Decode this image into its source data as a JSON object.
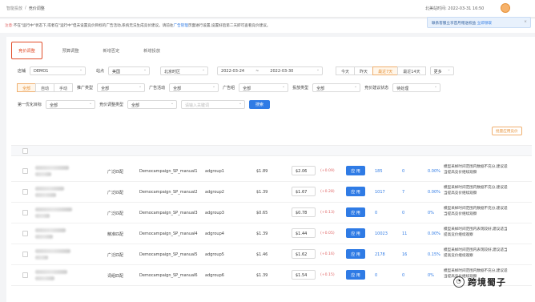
{
  "header": {
    "crumb1": "智能投放",
    "crumb_sep": "/",
    "crumb2": "竞价调整",
    "site_time_label": "北美站时间:",
    "site_time": "2022-03-31 16:50"
  },
  "notice": {
    "prefix": "注意:",
    "text1": "不在\"运行中\"状态下,或者在\"运行中\"但未设置竞价目标的广告活动,系统无法生成竞价建议。请前往",
    "link": "广告管理",
    "text2": "页面进行设置,设置好后第二天即可查看竞价建议。"
  },
  "promo": {
    "text": "联系客服立享首月赠送权益",
    "link": "立即领取",
    "close": "×"
  },
  "tabs": [
    {
      "label": "竞价调整"
    },
    {
      "label": "预算调整"
    },
    {
      "label": "新增否定"
    },
    {
      "label": "新增投放"
    }
  ],
  "filters1": {
    "shop_label": "店铺",
    "shop": "DEMO1",
    "site_label": "站点",
    "site": "美国",
    "timezone": "北京时区",
    "date_from": "2022-03-24",
    "date_sep": "~",
    "date_to": "2022-03-30",
    "quick": [
      "今天",
      "昨天",
      "最近7天",
      "最近14天"
    ],
    "more": "更多"
  },
  "filters2": {
    "all1": "全部",
    "mode1": "自动",
    "mode2": "手动",
    "ad_type_label": "推广类型",
    "ad_type": "全部",
    "campaign_label": "广告活动",
    "campaign": "全部",
    "group_label": "广告组",
    "group": "全部",
    "match_label": "投放类型",
    "match": "全部",
    "status_label": "竞价建议状态",
    "status": "待处理"
  },
  "filters3": {
    "seg_label": "第一优化目标",
    "seg": "全部",
    "bid_label": "竞价调整类型",
    "bid": "全部",
    "search_placeholder": "请输入关键词",
    "query_button": "搜索"
  },
  "apply_all": "批量应用竞价",
  "rows": [
    {
      "match": "广泛匹配",
      "campaign": "Democampaign_SP_manual1",
      "group": "adgroup1",
      "bid": "$1.89",
      "new_bid": "$2.06",
      "change": "(+0.09)",
      "apply": "应 用",
      "clicks": "185",
      "orders": "0",
      "acos": "0.00%",
      "msg": "模型采样时间范围内数据不充分,建议适当提高竞价继续观察"
    },
    {
      "match": "广泛匹配",
      "campaign": "Democampaign_SP_manual2",
      "group": "adgroup2",
      "bid": "$1.39",
      "new_bid": "$1.67",
      "change": "(+0.28)",
      "apply": "应 用",
      "clicks": "1017",
      "orders": "7",
      "acos": "0.00%",
      "msg": "模型采样时间范围内数据不充分,建议适当提高竞价继续观察"
    },
    {
      "match": "广泛匹配",
      "campaign": "Democampaign_SP_manual3",
      "group": "adgroup3",
      "bid": "$0.65",
      "new_bid": "$0.78",
      "change": "(+0.13)",
      "apply": "应 用",
      "clicks": "0",
      "orders": "0",
      "acos": "0%",
      "msg": "模型采样时间范围内数据不充分,建议适当提高竞价继续观察"
    },
    {
      "match": "精准匹配",
      "campaign": "Democampaign_SP_manual4",
      "group": "adgroup4",
      "bid": "$1.39",
      "new_bid": "$1.44",
      "change": "(+0.05)",
      "apply": "应 用",
      "clicks": "10023",
      "orders": "11",
      "acos": "0.00%",
      "msg": "模型采样时间范围内表现较好,建议适当提高竞价继续观察"
    },
    {
      "match": "广泛匹配",
      "campaign": "Democampaign_SP_manual5",
      "group": "adgroup5",
      "bid": "$1.46",
      "new_bid": "$1.62",
      "change": "(+0.16)",
      "apply": "应 用",
      "clicks": "2178",
      "orders": "16",
      "acos": "0.15%",
      "msg": "模型采样时间范围内表现较好,建议适当提高竞价继续观察"
    },
    {
      "match": "词组匹配",
      "campaign": "Democampaign_SP_manual6",
      "group": "adgroup6",
      "bid": "$1.39",
      "new_bid": "$1.54",
      "change": "(+0.15)",
      "apply": "应 用",
      "clicks": "0",
      "orders": "0",
      "acos": "0%",
      "msg": "模型采样时间范围内数据不充分,建议适当提高竞价继续观察"
    }
  ],
  "watermark": "跨境蜀子"
}
